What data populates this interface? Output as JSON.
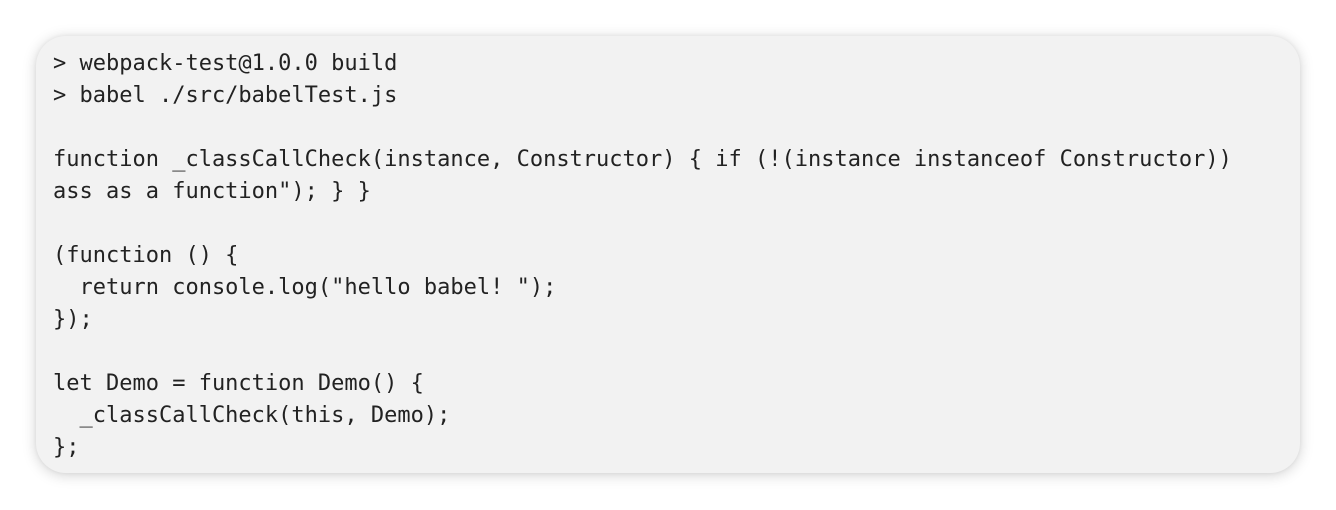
{
  "terminal": {
    "lines": [
      "> webpack-test@1.0.0 build",
      "> babel ./src/babelTest.js",
      "",
      "function _classCallCheck(instance, Constructor) { if (!(instance instanceof Constructor))",
      "ass as a function\"); } }",
      "",
      "(function () {",
      "  return console.log(\"hello babel! \");",
      "});",
      "",
      "let Demo = function Demo() {",
      "  _classCallCheck(this, Demo);",
      "};"
    ]
  }
}
